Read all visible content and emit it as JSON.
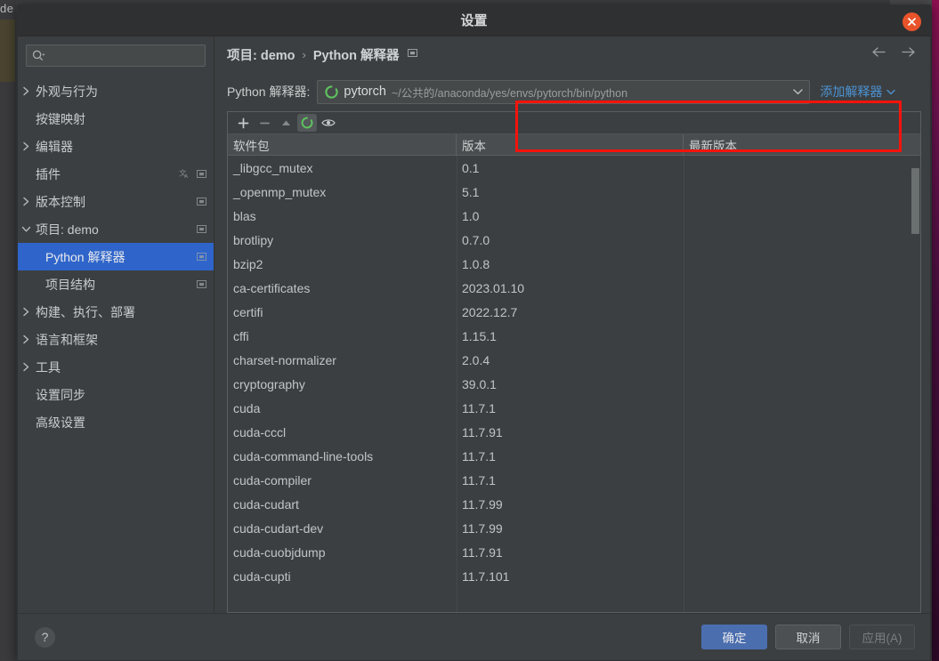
{
  "background": {
    "left_edge_text": "de"
  },
  "window": {
    "title": "设置",
    "close_label": "×"
  },
  "sidebar": {
    "search": {
      "value": "",
      "placeholder": ""
    },
    "items": [
      {
        "label": "外观与行为",
        "twisty": "chevron-right",
        "level": 0,
        "selected": false,
        "badges": []
      },
      {
        "label": "按键映射",
        "twisty": "none",
        "level": 0,
        "selected": false,
        "badges": []
      },
      {
        "label": "编辑器",
        "twisty": "chevron-right",
        "level": 0,
        "selected": false,
        "badges": []
      },
      {
        "label": "插件",
        "twisty": "none",
        "level": 0,
        "selected": false,
        "badges": [
          "translate",
          "module"
        ]
      },
      {
        "label": "版本控制",
        "twisty": "chevron-right",
        "level": 0,
        "selected": false,
        "badges": [
          "module"
        ]
      },
      {
        "label": "项目: demo",
        "twisty": "chevron-down",
        "level": 0,
        "selected": false,
        "badges": [
          "module"
        ]
      },
      {
        "label": "Python 解释器",
        "twisty": "none",
        "level": 1,
        "selected": true,
        "badges": [
          "module"
        ]
      },
      {
        "label": "项目结构",
        "twisty": "none",
        "level": 1,
        "selected": false,
        "badges": [
          "module"
        ]
      },
      {
        "label": "构建、执行、部署",
        "twisty": "chevron-right",
        "level": 0,
        "selected": false,
        "badges": []
      },
      {
        "label": "语言和框架",
        "twisty": "chevron-right",
        "level": 0,
        "selected": false,
        "badges": []
      },
      {
        "label": "工具",
        "twisty": "chevron-right",
        "level": 0,
        "selected": false,
        "badges": []
      },
      {
        "label": "设置同步",
        "twisty": "none",
        "level": 0,
        "selected": false,
        "badges": []
      },
      {
        "label": "高级设置",
        "twisty": "none",
        "level": 0,
        "selected": false,
        "badges": []
      }
    ]
  },
  "main": {
    "breadcrumb": {
      "parent": "项目: demo",
      "separator": "›",
      "current": "Python 解释器"
    },
    "interpreter": {
      "label": "Python 解释器:",
      "env_name": "pytorch",
      "path": "~/公共的/anaconda/yes/envs/pytorch/bin/python",
      "add_link": "添加解释器"
    },
    "packages": {
      "toolbar": [
        "add-icon",
        "remove-icon",
        "upgrade-icon",
        "conda-icon",
        "eye-icon"
      ],
      "columns": [
        "软件包",
        "版本",
        "最新版本"
      ],
      "rows": [
        {
          "name": "_libgcc_mutex",
          "version": "0.1",
          "latest": ""
        },
        {
          "name": "_openmp_mutex",
          "version": "5.1",
          "latest": ""
        },
        {
          "name": "blas",
          "version": "1.0",
          "latest": ""
        },
        {
          "name": "brotlipy",
          "version": "0.7.0",
          "latest": ""
        },
        {
          "name": "bzip2",
          "version": "1.0.8",
          "latest": ""
        },
        {
          "name": "ca-certificates",
          "version": "2023.01.10",
          "latest": ""
        },
        {
          "name": "certifi",
          "version": "2022.12.7",
          "latest": ""
        },
        {
          "name": "cffi",
          "version": "1.15.1",
          "latest": ""
        },
        {
          "name": "charset-normalizer",
          "version": "2.0.4",
          "latest": ""
        },
        {
          "name": "cryptography",
          "version": "39.0.1",
          "latest": ""
        },
        {
          "name": "cuda",
          "version": "11.7.1",
          "latest": ""
        },
        {
          "name": "cuda-cccl",
          "version": "11.7.91",
          "latest": ""
        },
        {
          "name": "cuda-command-line-tools",
          "version": "11.7.1",
          "latest": ""
        },
        {
          "name": "cuda-compiler",
          "version": "11.7.1",
          "latest": ""
        },
        {
          "name": "cuda-cudart",
          "version": "11.7.99",
          "latest": ""
        },
        {
          "name": "cuda-cudart-dev",
          "version": "11.7.99",
          "latest": ""
        },
        {
          "name": "cuda-cuobjdump",
          "version": "11.7.91",
          "latest": ""
        },
        {
          "name": "cuda-cupti",
          "version": "11.7.101",
          "latest": ""
        }
      ]
    }
  },
  "footer": {
    "help": "?",
    "ok": "确定",
    "cancel": "取消",
    "apply": "应用(A)"
  },
  "colors": {
    "accent_selection": "#2f65ca",
    "primary_button": "#4b6eaf",
    "link": "#4c93d4",
    "annotation_red": "#f5130b",
    "env_green": "#4caf50",
    "close_orange": "#e9532a",
    "window_bg": "#3c3f41"
  }
}
